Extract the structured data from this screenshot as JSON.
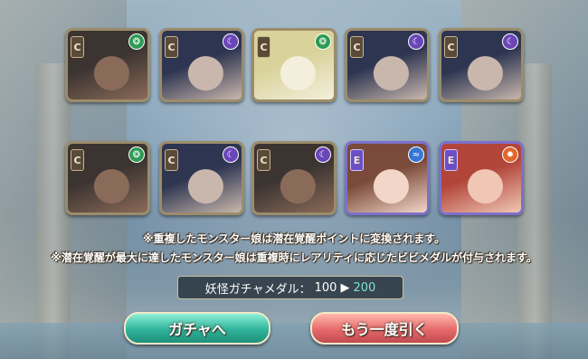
{
  "cards": [
    {
      "rank": "C",
      "attribute": "wind",
      "attr_color": "#2e9a55",
      "portrait": "masked-girl-dark-hair",
      "tone": [
        "#3b3431",
        "#8a6a58"
      ]
    },
    {
      "rank": "C",
      "attribute": "dark",
      "attr_color": "#6a46b8",
      "portrait": "navy-hair-girl",
      "tone": [
        "#2d3550",
        "#c9b7ad"
      ]
    },
    {
      "rank": "C",
      "attribute": "wind",
      "attr_color": "#2e9a55",
      "portrait": "blonde-blue-eyed-girl",
      "tone": [
        "#d9d39b",
        "#f3efdc"
      ]
    },
    {
      "rank": "C",
      "attribute": "dark",
      "attr_color": "#6a46b8",
      "portrait": "navy-hair-girl",
      "tone": [
        "#2d3550",
        "#c9b7ad"
      ]
    },
    {
      "rank": "C",
      "attribute": "dark",
      "attr_color": "#6a46b8",
      "portrait": "navy-hair-girl",
      "tone": [
        "#2d3550",
        "#c9b7ad"
      ]
    },
    {
      "rank": "C",
      "attribute": "wind",
      "attr_color": "#2e9a55",
      "portrait": "masked-girl-dark-hair",
      "tone": [
        "#3b3431",
        "#8a6a58"
      ]
    },
    {
      "rank": "C",
      "attribute": "dark",
      "attr_color": "#6a46b8",
      "portrait": "navy-hair-girl",
      "tone": [
        "#2d3550",
        "#c9b7ad"
      ]
    },
    {
      "rank": "C",
      "attribute": "dark",
      "attr_color": "#6a46b8",
      "portrait": "masked-girl-dark-hair",
      "tone": [
        "#3b3431",
        "#8a6a58"
      ]
    },
    {
      "rank": "E",
      "attribute": "water",
      "attr_color": "#3576d6",
      "portrait": "brown-hair-cheerful-girl",
      "tone": [
        "#7a4a3a",
        "#f2d6c8"
      ]
    },
    {
      "rank": "E",
      "attribute": "fire",
      "attr_color": "#e0672a",
      "portrait": "red-hair-girl",
      "tone": [
        "#b2453a",
        "#f0c7b4"
      ]
    }
  ],
  "notes": {
    "line1": "※重複したモンスター娘は潜在覚醒ポイントに変換されます。",
    "line2": "※潜在覚醒が最大に達したモンスター娘は重複時にレアリティに応じたビビメダルが付与されます。"
  },
  "medal": {
    "label": "妖怪ガチャメダル：",
    "old": "100",
    "arrow": "▶",
    "new": "200"
  },
  "buttons": {
    "gacha": "ガチャへ",
    "again": "もう一度引く"
  }
}
